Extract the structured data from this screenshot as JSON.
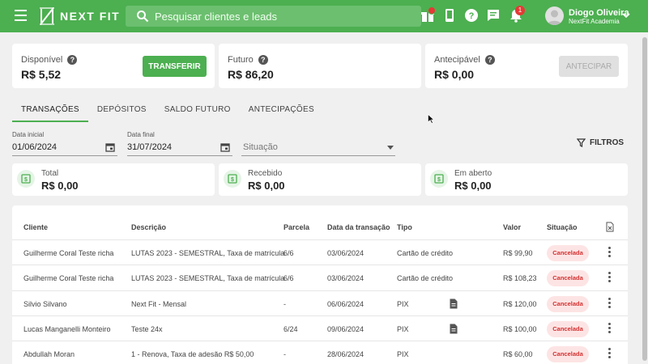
{
  "header": {
    "brand": "NEXT FIT",
    "search_placeholder": "Pesquisar clientes e leads",
    "notifications_count": "1",
    "user_name": "Diogo Oliveira",
    "user_org": "NextFit Academia"
  },
  "balances": {
    "available": {
      "label": "Disponível",
      "value": "R$ 5,52",
      "button": "TRANSFERIR"
    },
    "future": {
      "label": "Futuro",
      "value": "R$ 86,20"
    },
    "anticipable": {
      "label": "Antecipável",
      "value": "R$ 0,00",
      "button": "ANTECIPAR"
    }
  },
  "tabs": [
    "TRANSAÇÕES",
    "DEPÓSITOS",
    "SALDO FUTURO",
    "ANTECIPAÇÕES"
  ],
  "filters": {
    "start_label": "Data inicial",
    "start_value": "01/06/2024",
    "end_label": "Data final",
    "end_value": "31/07/2024",
    "situation_placeholder": "Situação",
    "filters_button": "FILTROS"
  },
  "summary": {
    "total": {
      "label": "Total",
      "value": "R$ 0,00"
    },
    "received": {
      "label": "Recebido",
      "value": "R$ 0,00"
    },
    "open": {
      "label": "Em aberto",
      "value": "R$ 0,00"
    }
  },
  "table": {
    "headers": {
      "client": "Cliente",
      "description": "Descrição",
      "installment": "Parcela",
      "date": "Data da transação",
      "type": "Tipo",
      "value": "Valor",
      "status": "Situação"
    },
    "rows": [
      {
        "client": "Guilherme Coral Teste richa",
        "description": "LUTAS 2023 - SEMESTRAL, Taxa de matrícula",
        "installment": "6/6",
        "date": "03/06/2024",
        "type": "Cartão de crédito",
        "value": "R$ 99,90",
        "status": "Cancelada"
      },
      {
        "client": "Guilherme Coral Teste richa",
        "description": "LUTAS 2023 - SEMESTRAL, Taxa de matrícula",
        "installment": "6/6",
        "date": "03/06/2024",
        "type": "Cartão de crédito",
        "value": "R$ 108,23",
        "status": "Cancelada"
      },
      {
        "client": "Silvio Silvano",
        "description": "Next Fit - Mensal",
        "installment": "-",
        "date": "06/06/2024",
        "type": "PIX",
        "value": "R$ 120,00",
        "status": "Cancelada"
      },
      {
        "client": "Lucas Manganelli Monteiro",
        "description": "Teste 24x",
        "installment": "6/24",
        "date": "09/06/2024",
        "type": "PIX",
        "value": "R$ 100,00",
        "status": "Cancelada"
      },
      {
        "client": "Abdullah Moran",
        "description": "1 - Renova, Taxa de adesão R$ 50,00",
        "installment": "-",
        "date": "28/06/2024",
        "type": "PIX",
        "value": "R$ 60,00",
        "status": "Cancelada"
      }
    ]
  },
  "colors": {
    "brand": "#4caf50",
    "danger": "#d32f2f",
    "danger_bg": "#fde4e4"
  }
}
